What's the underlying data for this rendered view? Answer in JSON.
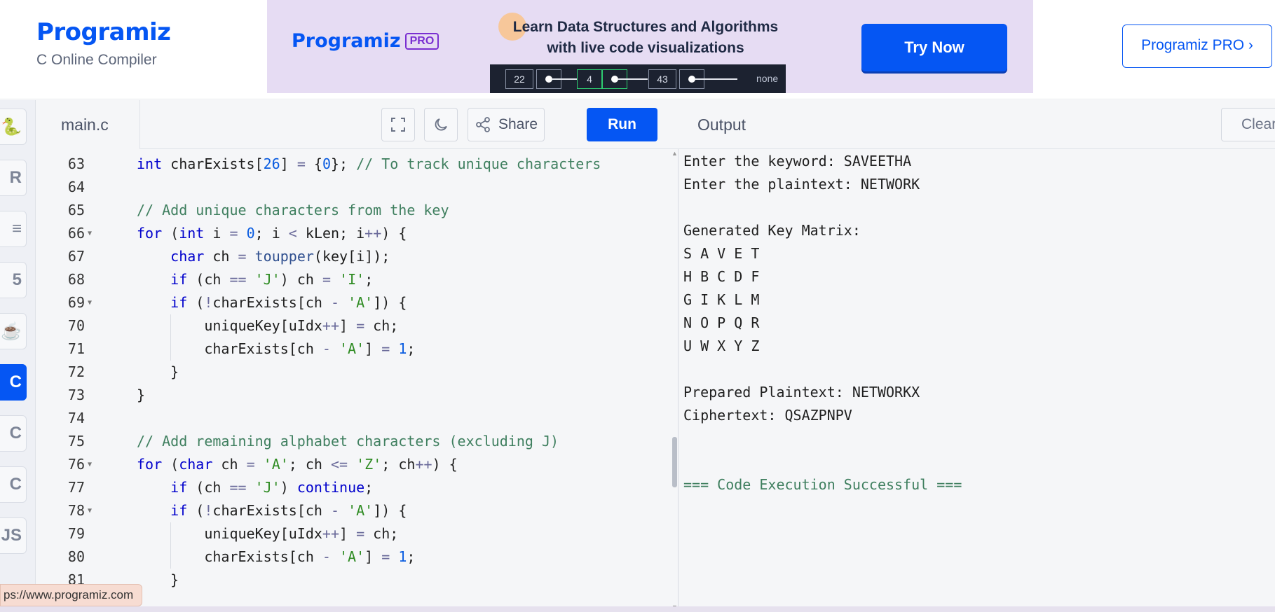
{
  "header": {
    "brand": "Programiz",
    "subtitle": "C Online Compiler",
    "pro_link_label": "Programiz PRO ›"
  },
  "ad": {
    "logo_text": "Programiz",
    "pro_tag": "PRO",
    "headline_line1": "Learn Data Structures and Algorithms",
    "headline_line2": "with live code visualizations",
    "viz_nodes": [
      "22",
      "4",
      "43"
    ],
    "viz_end": "none",
    "cta_label": "Try Now"
  },
  "sidebar": {
    "languages": [
      {
        "name": "python-icon",
        "glyph": "🐍"
      },
      {
        "name": "r-icon",
        "glyph": "R"
      },
      {
        "name": "sql-icon",
        "glyph": "≡"
      },
      {
        "name": "html-icon",
        "glyph": "5"
      },
      {
        "name": "java-icon",
        "glyph": "☕"
      },
      {
        "name": "c-icon",
        "glyph": "C",
        "active": true
      },
      {
        "name": "cpp-icon",
        "glyph": "C"
      },
      {
        "name": "csharp-icon",
        "glyph": "C"
      },
      {
        "name": "js-icon",
        "glyph": "JS"
      }
    ]
  },
  "editor": {
    "filename": "main.c",
    "share_label": "Share",
    "run_label": "Run",
    "lines": [
      {
        "n": "63",
        "text": "int charExists[26] = {0}; // To track unique characters"
      },
      {
        "n": "64",
        "text": ""
      },
      {
        "n": "65",
        "text": "// Add unique characters from the key"
      },
      {
        "n": "66",
        "text": "for (int i = 0; i < kLen; i++) {"
      },
      {
        "n": "67",
        "text": "    char ch = toupper(key[i]);"
      },
      {
        "n": "68",
        "text": "    if (ch == 'J') ch = 'I';"
      },
      {
        "n": "69",
        "text": "    if (!charExists[ch - 'A']) {"
      },
      {
        "n": "70",
        "text": "        uniqueKey[uIdx++] = ch;"
      },
      {
        "n": "71",
        "text": "        charExists[ch - 'A'] = 1;"
      },
      {
        "n": "72",
        "text": "    }"
      },
      {
        "n": "73",
        "text": "}"
      },
      {
        "n": "74",
        "text": ""
      },
      {
        "n": "75",
        "text": "// Add remaining alphabet characters (excluding J)"
      },
      {
        "n": "76",
        "text": "for (char ch = 'A'; ch <= 'Z'; ch++) {"
      },
      {
        "n": "77",
        "text": "    if (ch == 'J') continue;"
      },
      {
        "n": "78",
        "text": "    if (!charExists[ch - 'A']) {"
      },
      {
        "n": "79",
        "text": "        uniqueKey[uIdx++] = ch;"
      },
      {
        "n": "80",
        "text": "        charExists[ch - 'A'] = 1;"
      },
      {
        "n": "81",
        "text": "    }"
      }
    ]
  },
  "output": {
    "title": "Output",
    "clear_label": "Clear",
    "lines": [
      "Enter the keyword: SAVEETHA",
      "Enter the plaintext: NETWORK",
      "",
      "Generated Key Matrix:",
      "S A V E T",
      "H B C D F",
      "G I K L M",
      "N O P Q R",
      "U W X Y Z",
      "",
      "Prepared Plaintext: NETWORKX",
      "Ciphertext: QSAZPNPV",
      "",
      "",
      "=== Code Execution Successful ==="
    ]
  },
  "status_url": "ps://www.programiz.com",
  "colors": {
    "brand_blue": "#0556f3",
    "banner_bg": "#e6dcf3",
    "keyword": "#0000cc",
    "comment": "#3f7f5f",
    "string": "#2e8b22",
    "number": "#0a5ce0"
  }
}
